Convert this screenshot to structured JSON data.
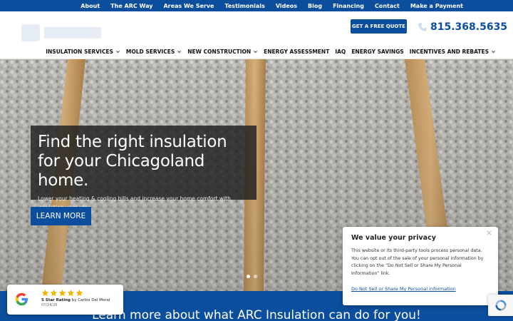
{
  "topnav": {
    "items": [
      "About",
      "The ARC Way",
      "Areas We Serve",
      "Testimonials",
      "Videos",
      "Blog",
      "Financing",
      "Contact",
      "Make a Payment"
    ]
  },
  "header": {
    "quote_button": "GET A FREE QUOTE",
    "phone": "815.368.5635",
    "phone_icon": "phone-icon"
  },
  "mainnav": {
    "items": [
      {
        "label": "INSULATION SERVICES",
        "dropdown": true
      },
      {
        "label": "MOLD SERVICES",
        "dropdown": true
      },
      {
        "label": "NEW CONSTRUCTION",
        "dropdown": true
      },
      {
        "label": "ENERGY ASSESSMENT",
        "dropdown": false
      },
      {
        "label": "IAQ",
        "dropdown": false
      },
      {
        "label": "ENERGY SAVINGS",
        "dropdown": false
      },
      {
        "label": "INCENTIVES AND REBATES",
        "dropdown": true
      }
    ]
  },
  "hero": {
    "title": "Find the right insulation for your Chicagoland home.",
    "subtitle": "Lower your heating & cooling bills and increase your home comfort with insulation upgrades.",
    "cta": "LEARN MORE"
  },
  "band": {
    "text": "Learn more about what ARC Insulation can do for you!"
  },
  "review": {
    "stars": 5,
    "rating_label": "5 Star Rating",
    "by_label": "by Carlos Del Moral",
    "date": "07/24/26"
  },
  "privacy": {
    "title": "We value your privacy",
    "body": "This website or its third-party tools process personal data. You can opt out of the sale of your personal information by clicking on the “Do Not Sell or Share My Personal Information” link.",
    "link": "Do Not Sell or Share My Personal Information",
    "close_icon": "close-icon"
  },
  "colors": {
    "brand_blue": "#0b4e9e",
    "star_gold": "#f5b400"
  }
}
